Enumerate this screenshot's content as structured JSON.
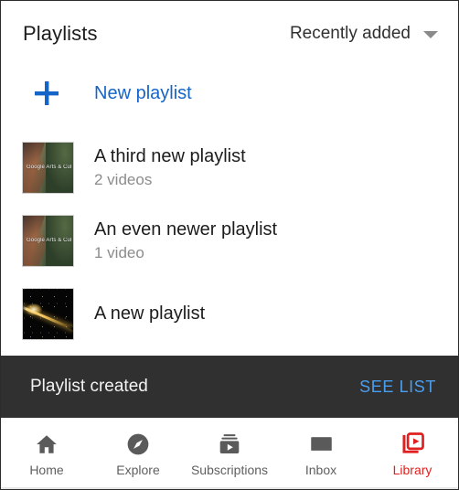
{
  "header": {
    "title": "Playlists",
    "sort_label": "Recently added",
    "caret_icon": "chevron-down-icon"
  },
  "new_playlist": {
    "label": "New playlist",
    "icon": "plus-icon",
    "accent_color": "#1565c8"
  },
  "playlists": [
    {
      "title": "A third new playlist",
      "subtitle": "2 videos",
      "thumbnail": "canyon-cliff-forest",
      "thumbnail_watermark": "Google Arts & Cul"
    },
    {
      "title": "An even newer playlist",
      "subtitle": "1 video",
      "thumbnail": "canyon-cliff-forest",
      "thumbnail_watermark": "Google Arts & Cul"
    },
    {
      "title": "A new playlist",
      "subtitle": "",
      "thumbnail": "golden-light-streak",
      "thumbnail_watermark": ""
    }
  ],
  "snackbar": {
    "message": "Playlist created",
    "action_label": "SEE LIST",
    "background_color": "#303030",
    "action_color": "#4a9eef"
  },
  "bottom_nav": {
    "active": "Library",
    "active_color": "#e02020",
    "items": [
      {
        "label": "Home",
        "icon": "home-icon"
      },
      {
        "label": "Explore",
        "icon": "compass-icon"
      },
      {
        "label": "Subscriptions",
        "icon": "subscriptions-icon"
      },
      {
        "label": "Inbox",
        "icon": "envelope-icon"
      },
      {
        "label": "Library",
        "icon": "library-play-icon"
      }
    ]
  }
}
